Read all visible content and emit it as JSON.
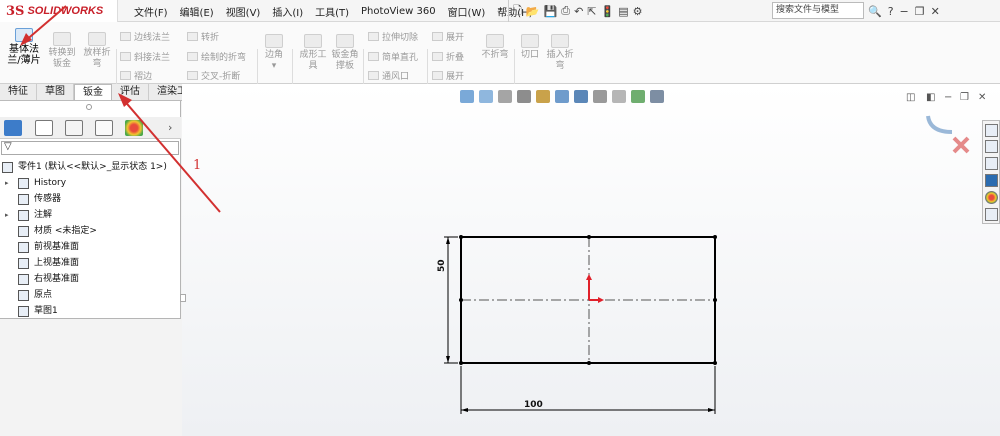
{
  "app": {
    "logo_ds": "3S",
    "logo_text": "SOLIDWORKS"
  },
  "menu": [
    "文件(F)",
    "编辑(E)",
    "视图(V)",
    "插入(I)",
    "工具(T)",
    "PhotoView 360",
    "窗口(W)",
    "帮助(H)"
  ],
  "search": {
    "placeholder": "搜索文件与模型"
  },
  "title_right": {
    "help": "?",
    "minimize_label": "−",
    "restore_label": "❐",
    "close_label": "✕"
  },
  "ribbon": {
    "base_flange": {
      "line1": "基体法",
      "line2": "兰/薄片"
    },
    "convert_sheet": {
      "line1": "转换到",
      "line2": "钣金"
    },
    "lofted_bend": {
      "line1": "放样折",
      "line2": "弯"
    },
    "edge_flange": "边线法兰",
    "miter_flange": "斜接法兰",
    "hem": "褶边",
    "jog": "转折",
    "sketched_bend": "绘制的折弯",
    "cross_break": "交叉-折断",
    "corners": "边角",
    "forming_tool": {
      "line1": "成形工",
      "line2": "具"
    },
    "sheet_gusset": {
      "line1": "钣金角",
      "line2": "撑板"
    },
    "extruded_cut": "拉伸切除",
    "simple_hole": "简单直孔",
    "vent": "通风口",
    "unfold": "展开",
    "fold": "折叠",
    "flatten": "展开",
    "no_bends": "不折弯",
    "rip": "切口",
    "insert_bends": {
      "line1": "插入折",
      "line2": "弯"
    }
  },
  "tabs": [
    "特征",
    "草图",
    "钣金",
    "评估",
    "渲染工具"
  ],
  "tree": [
    {
      "label": "零件1 (默认<<默认>_显示状态 1>)",
      "level": 0,
      "arrow": ""
    },
    {
      "label": "History",
      "level": 1,
      "arrow": "▸"
    },
    {
      "label": "传感器",
      "level": 1,
      "arrow": ""
    },
    {
      "label": "注解",
      "level": 1,
      "arrow": "▸"
    },
    {
      "label": "材质 <未指定>",
      "level": 1,
      "arrow": ""
    },
    {
      "label": "前视基准面",
      "level": 1,
      "arrow": ""
    },
    {
      "label": "上视基准面",
      "level": 1,
      "arrow": ""
    },
    {
      "label": "右视基准面",
      "level": 1,
      "arrow": ""
    },
    {
      "label": "原点",
      "level": 1,
      "arrow": ""
    },
    {
      "label": "草图1",
      "level": 1,
      "arrow": ""
    }
  ],
  "sketch": {
    "dim_width": "100",
    "dim_height": "50"
  },
  "annotation": {
    "step_number": "1",
    "color": "#d23030"
  },
  "colors": {
    "accent": "#c8202a",
    "origin_arrow": "#e0202a"
  }
}
